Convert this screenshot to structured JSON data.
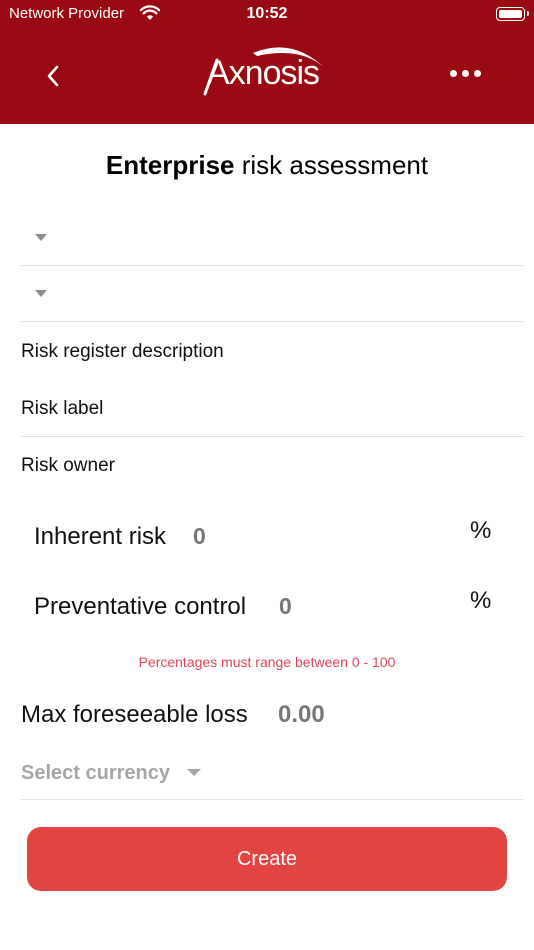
{
  "status_bar": {
    "carrier": "Network Provider",
    "time": "10:52"
  },
  "header": {
    "logo_text": "Axnosis",
    "back_icon": "chevron-left-icon",
    "more_icon": "more-horizontal-icon",
    "background_color": "#9a0a12"
  },
  "page": {
    "title_bold": "Enterprise",
    "title_rest": " risk assessment"
  },
  "form": {
    "dropdown_1": "",
    "dropdown_2": "",
    "risk_register_description": "Risk register description",
    "risk_label": "Risk label",
    "risk_owner": "Risk owner",
    "inherent_risk_label": "Inherent risk",
    "inherent_risk_value": "0",
    "preventative_control_label": "Preventative control",
    "preventative_control_value": "0",
    "percent_sign": "%",
    "range_hint": "Percentages must range between 0 - 100",
    "max_loss_label": "Max foreseeable loss",
    "max_loss_value": "0.00",
    "currency_placeholder": "Select currency",
    "hint_color": "#e0455b"
  },
  "actions": {
    "create_label": "Create",
    "create_color": "#e24442"
  }
}
